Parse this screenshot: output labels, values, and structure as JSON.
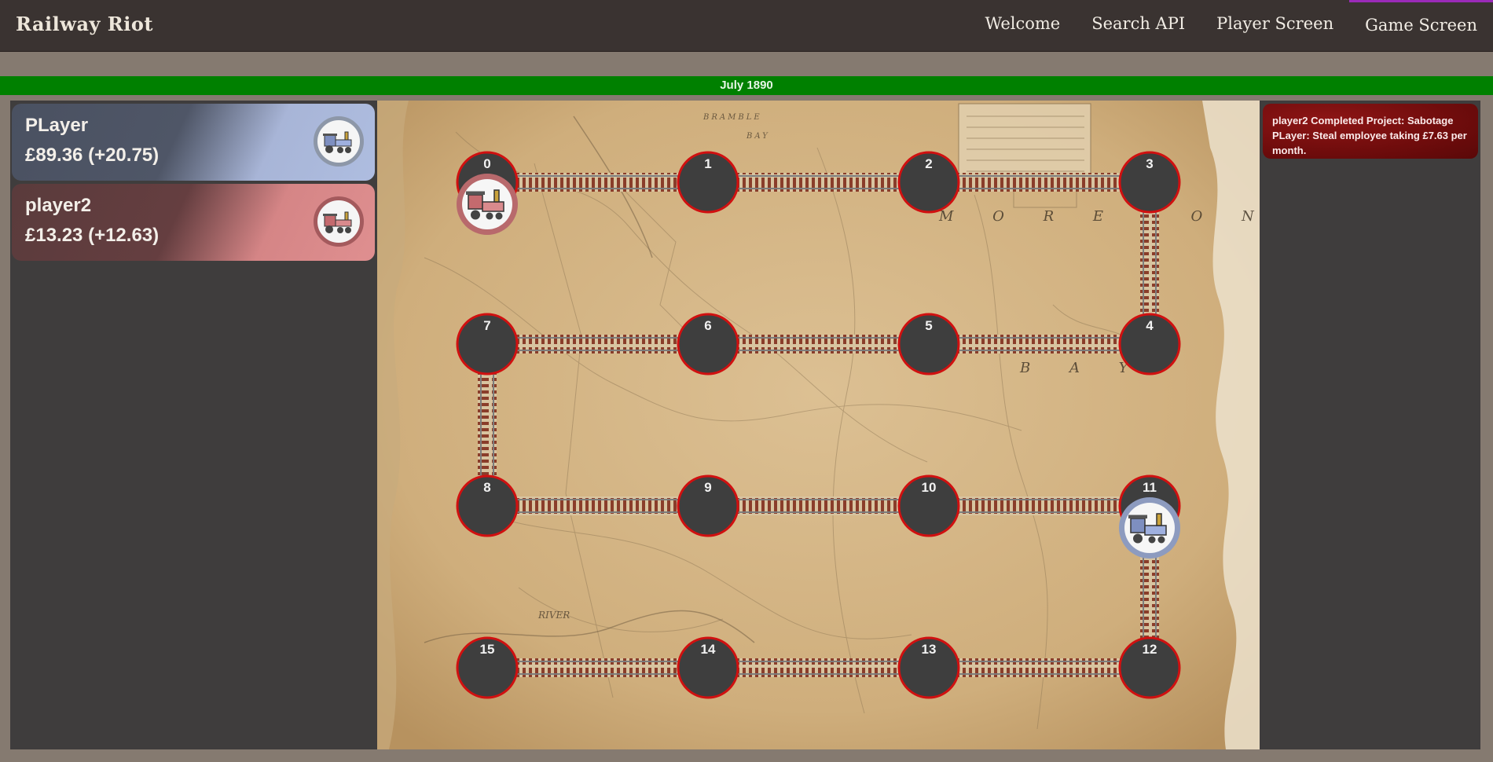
{
  "app": {
    "title": "Railway Riot"
  },
  "nav": {
    "items": [
      {
        "label": "Welcome",
        "active": false
      },
      {
        "label": "Search API",
        "active": false
      },
      {
        "label": "Player Screen",
        "active": false
      },
      {
        "label": "Game Screen",
        "active": true
      }
    ]
  },
  "date": {
    "label": "July 1890"
  },
  "players": [
    {
      "name": "PLayer",
      "money": "£89.36 (+20.75)",
      "color": "#aebde0",
      "icon": "locomotive-blue-icon"
    },
    {
      "name": "player2",
      "money": "£13.23 (+12.63)",
      "color": "#df8f90",
      "icon": "locomotive-red-icon"
    }
  ],
  "events": [
    {
      "text": "player2 Completed Project: Sabotage PLayer: Steal employee taking £7.63 per month."
    }
  ],
  "board": {
    "stations": [
      {
        "id": "0"
      },
      {
        "id": "1"
      },
      {
        "id": "2"
      },
      {
        "id": "3"
      },
      {
        "id": "4"
      },
      {
        "id": "5"
      },
      {
        "id": "6"
      },
      {
        "id": "7"
      },
      {
        "id": "8"
      },
      {
        "id": "9"
      },
      {
        "id": "10"
      },
      {
        "id": "11"
      },
      {
        "id": "12"
      },
      {
        "id": "13"
      },
      {
        "id": "14"
      },
      {
        "id": "15"
      }
    ],
    "tokens": [
      {
        "player": "player2",
        "station": "0",
        "icon": "locomotive-red-icon"
      },
      {
        "player": "PLayer",
        "station": "11",
        "icon": "locomotive-blue-icon"
      }
    ],
    "map_labels": [
      "M O R E T O N",
      "B A Y",
      "RIVER",
      "BRAMBLE",
      "BAY"
    ],
    "colors": {
      "station_fill": "#3e3e3e",
      "station_ring": "#d01010",
      "track_tie": "#8a3d2a",
      "track_rail": "#7d7d7d"
    }
  }
}
